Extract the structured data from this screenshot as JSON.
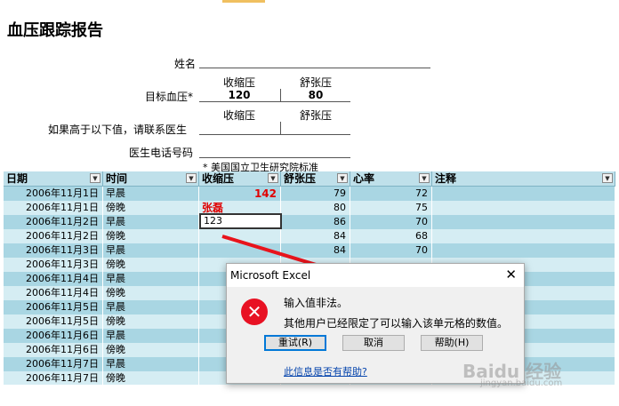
{
  "report": {
    "title": "血压跟踪报告",
    "name_label": "姓名",
    "systolic_label": "收缩压",
    "diastolic_label": "舒张压",
    "target_label": "目标血压*",
    "target_systolic": "120",
    "target_diastolic": "80",
    "alert_label": "如果高于以下值，请联系医生",
    "alert_systolic_label": "收缩压",
    "alert_diastolic_label": "舒张压",
    "phone_label": "医生电话号码",
    "footnote": "* 美国国立卫生研究院标准"
  },
  "table": {
    "headers": [
      "日期",
      "时间",
      "收缩压",
      "舒张压",
      "心率",
      "注释"
    ],
    "rows": [
      {
        "date": "2006年11月1日",
        "time": "早晨",
        "systolic": "142",
        "diastolic": "79",
        "pulse": "72"
      },
      {
        "date": "2006年11月1日",
        "time": "傍晚",
        "systolic": "张磊",
        "diastolic": "80",
        "pulse": "75"
      },
      {
        "date": "2006年11月2日",
        "time": "早晨",
        "systolic": "123",
        "diastolic": "86",
        "pulse": "70"
      },
      {
        "date": "2006年11月2日",
        "time": "傍晚",
        "systolic": "",
        "diastolic": "84",
        "pulse": "68"
      },
      {
        "date": "2006年11月3日",
        "time": "早晨",
        "systolic": "",
        "diastolic": "84",
        "pulse": "70"
      },
      {
        "date": "2006年11月3日",
        "time": "傍晚",
        "systolic": "",
        "diastolic": "",
        "pulse": ""
      },
      {
        "date": "2006年11月4日",
        "time": "早晨",
        "systolic": "",
        "diastolic": "",
        "pulse": ""
      },
      {
        "date": "2006年11月4日",
        "time": "傍晚",
        "systolic": "",
        "diastolic": "",
        "pulse": ""
      },
      {
        "date": "2006年11月5日",
        "time": "早晨",
        "systolic": "",
        "diastolic": "",
        "pulse": ""
      },
      {
        "date": "2006年11月5日",
        "time": "傍晚",
        "systolic": "",
        "diastolic": "",
        "pulse": ""
      },
      {
        "date": "2006年11月6日",
        "time": "早晨",
        "systolic": "",
        "diastolic": "",
        "pulse": ""
      },
      {
        "date": "2006年11月6日",
        "time": "傍晚",
        "systolic": "",
        "diastolic": "",
        "pulse": ""
      },
      {
        "date": "2006年11月7日",
        "time": "早晨",
        "systolic": "",
        "diastolic": "",
        "pulse": ""
      },
      {
        "date": "2006年11月7日",
        "time": "傍晚",
        "systolic": "",
        "diastolic": "",
        "pulse": ""
      }
    ]
  },
  "dialog": {
    "title": "Microsoft Excel",
    "close": "✕",
    "message1": "输入值非法。",
    "message2": "其他用户已经限定了可以输入该单元格的数值。",
    "retry": "重试(R)",
    "cancel": "取消",
    "help": "帮助(H)",
    "link": "此信息是否有帮助?",
    "icon": "error-icon"
  },
  "watermark": {
    "brand": "Baidu 经验",
    "url": "jingyan.baidu.com"
  },
  "colors": {
    "row_dark": "#a9d6e3",
    "row_light": "#d5edf3",
    "header": "#bfe0ea",
    "error_red": "#e81123",
    "arrow_red": "#e8141c"
  }
}
